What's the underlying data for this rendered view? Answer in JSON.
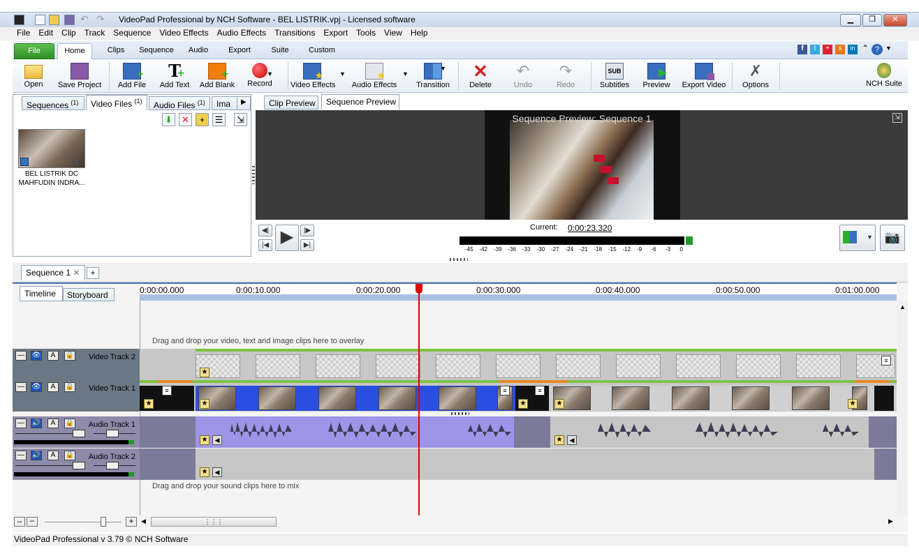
{
  "window": {
    "title": "VideoPad Professional by NCH Software - BEL LISTRIK.vpj - Licensed software"
  },
  "menu": [
    "File",
    "Edit",
    "Clip",
    "Track",
    "Sequence",
    "Video Effects",
    "Audio Effects",
    "Transitions",
    "Export",
    "Tools",
    "View",
    "Help"
  ],
  "ribbon_tabs": [
    "File",
    "Home",
    "Clips",
    "Sequence",
    "Audio",
    "Export",
    "Suite",
    "Custom"
  ],
  "ribbon_buttons": {
    "open": "Open",
    "save_project": "Save Project",
    "add_file": "Add File",
    "add_text": "Add Text",
    "add_blank": "Add Blank",
    "record": "Record",
    "video_effects": "Video Effects",
    "audio_effects": "Audio Effects",
    "transition": "Transition",
    "delete": "Delete",
    "undo": "Undo",
    "redo": "Redo",
    "subtitles": "Subtitles",
    "preview": "Preview",
    "export_video": "Export Video",
    "options": "Options",
    "nch_suite": "NCH Suite"
  },
  "subtitles_icon_text": "SUB",
  "bin_tabs": [
    {
      "label": "Sequences",
      "count": "(1)"
    },
    {
      "label": "Video Files",
      "count": "(1)"
    },
    {
      "label": "Audio Files",
      "count": "(1)"
    },
    {
      "label": "Ima",
      "count": ""
    }
  ],
  "bin_item": {
    "line1": "BEL LISTRIK DC",
    "line2": "MAHFUDIN INDRA..."
  },
  "preview_tabs": [
    "Clip Preview",
    "Sequence Preview"
  ],
  "preview": {
    "title": "Sequence Preview: Sequence 1",
    "current_label": "Current:",
    "current_time": "0:00:23.320"
  },
  "level_meter_ticks": [
    "-45",
    "-42",
    "-39",
    "-36",
    "-33",
    "-30",
    "-27",
    "-24",
    "-21",
    "-18",
    "-15",
    "-12",
    "-9",
    "-6",
    "-3",
    "0"
  ],
  "sequence_tab": "Sequence 1",
  "timeline_tabs": [
    "Timeline",
    "Storyboard"
  ],
  "ruler": [
    "0:00:00.000",
    "0:00:10.000",
    "0:00:20.000",
    "0:00:30.000",
    "0:00:40.000",
    "0:00:50.000",
    "0:01:00.000"
  ],
  "overlay_hint": "Drag and drop your video, text and image clips here to overlay",
  "mix_hint": "Drag and drop your sound clips here to mix",
  "tracks": {
    "video2": "Video Track 2",
    "video1": "Video Track 1",
    "audio1": "Audio Track 1",
    "audio2": "Audio Track 2"
  },
  "status": "VideoPad Professional v 3.79 © NCH Software",
  "accent": "#2a6fd1",
  "playhead_color": "#e00000"
}
